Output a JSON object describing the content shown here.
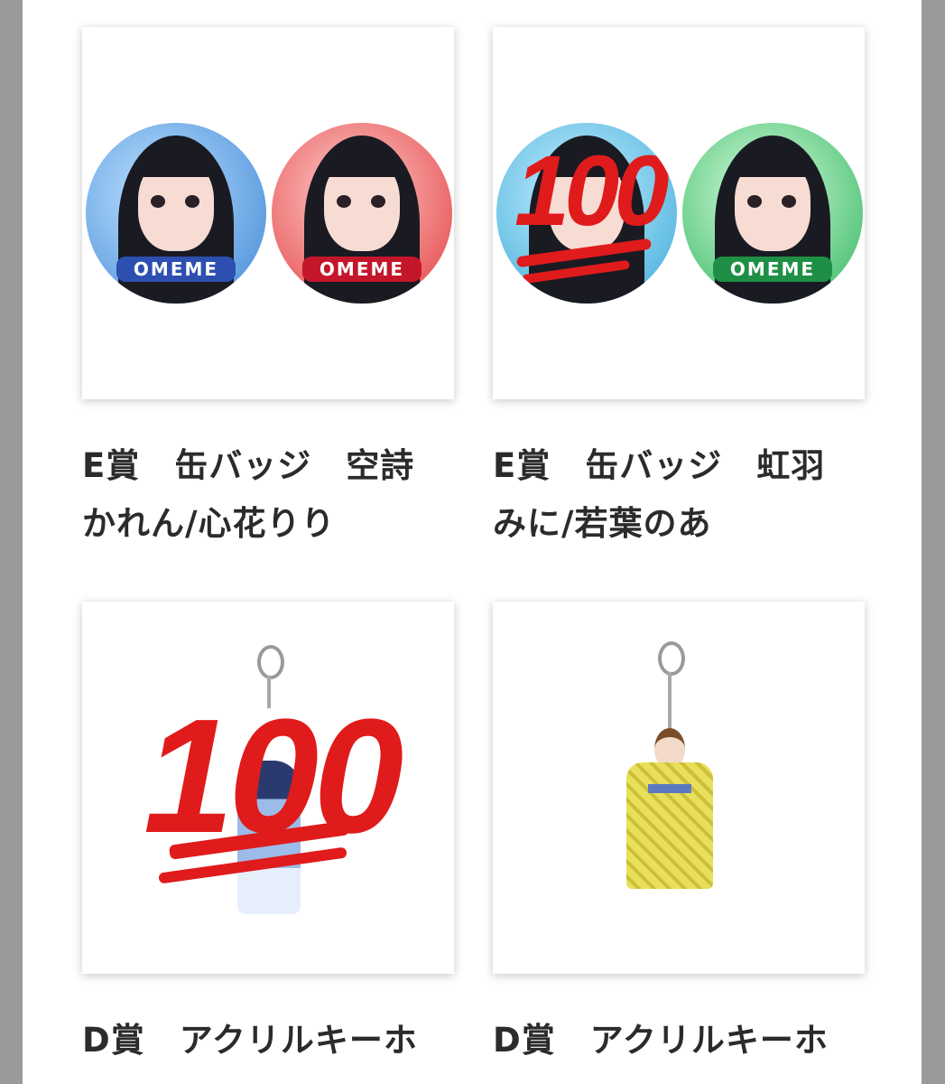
{
  "items": [
    {
      "title": "E賞　缶バッジ　空詩かれん/心花りり"
    },
    {
      "title": "E賞　缶バッジ　虹羽みに/若葉のあ"
    },
    {
      "title": "D賞　アクリルキーホ"
    },
    {
      "title": "D賞　アクリルキーホ"
    }
  ],
  "badges": {
    "logo_text": "OMEME",
    "hundred": "100"
  },
  "colors": {
    "blue_badge": "#6fb3ea",
    "red_badge": "#f26a6a",
    "green_badge": "#5fcf84",
    "hundred_red": "#e01b1b",
    "kimono_yellow": "#e6dc55"
  }
}
